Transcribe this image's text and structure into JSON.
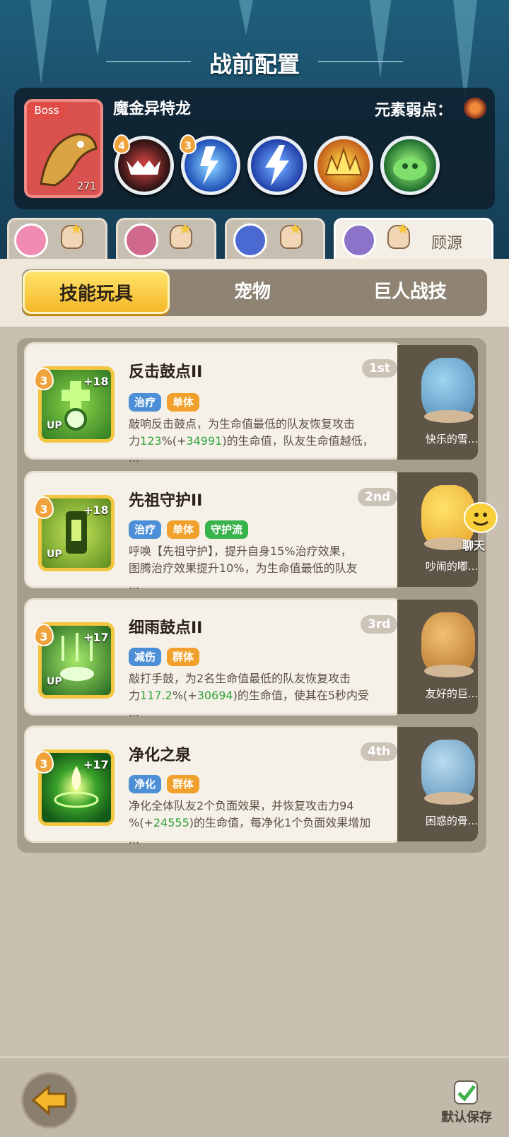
{
  "header": {
    "title": "战前配置"
  },
  "boss": {
    "label": "Boss",
    "level": "271",
    "name": "魔金异特龙",
    "weakness_label": "元素弱点："
  },
  "boss_skills": [
    {
      "icon": "sharp-teeth-mouth-icon",
      "count": "4",
      "color": "#3a1a1a"
    },
    {
      "icon": "multi-lightning-icon",
      "count": "3",
      "color": "#2d74d4"
    },
    {
      "icon": "lightning-bolt-icon",
      "count": "",
      "color": "#3a6ad9"
    },
    {
      "icon": "golden-spike-crown-icon",
      "count": "",
      "color": "#e0892a"
    },
    {
      "icon": "green-slime-icon",
      "count": "",
      "color": "#3da24a"
    }
  ],
  "hero_tabs": [
    {
      "name": "",
      "avatar_color": "#f08bb2"
    },
    {
      "name": "",
      "avatar_color": "#d1688d"
    },
    {
      "name": "",
      "avatar_color": "#4a6ad2"
    },
    {
      "name": "顾源",
      "avatar_color": "#8b73c9"
    }
  ],
  "categories": [
    {
      "label": "技能玩具",
      "active": true
    },
    {
      "label": "宠物",
      "active": false
    },
    {
      "label": "巨人战技",
      "active": false
    }
  ],
  "skills": [
    {
      "name": "反击鼓点II",
      "rank": "1st",
      "level": "3",
      "plus": "+18",
      "up": "UP",
      "tags": [
        {
          "text": "治疗",
          "color": "blue"
        },
        {
          "text": "单体",
          "color": "orange"
        }
      ],
      "desc_line1": "敲响反击鼓点，为生命值最低的队友恢复攻击",
      "desc_line2_a": "力",
      "desc_line2_b": "123",
      "desc_line2_c": "%(+",
      "desc_line2_d": "34991",
      "desc_line2_e": ")的生命值，队友生命值越低，",
      "desc_line3": "...",
      "pet_name": "快乐的雪..."
    },
    {
      "name": "先祖守护II",
      "rank": "2nd",
      "level": "3",
      "plus": "+18",
      "up": "UP",
      "tags": [
        {
          "text": "治疗",
          "color": "blue"
        },
        {
          "text": "单体",
          "color": "orange"
        },
        {
          "text": "守护流",
          "color": "green"
        }
      ],
      "desc_line1": "呼唤【先祖守护】，提升自身15%治疗效果，",
      "desc_line2_a": "图腾治疗效果提升10%，为生命值最低的队友",
      "desc_line2_b": "",
      "desc_line2_c": "",
      "desc_line2_d": "",
      "desc_line2_e": "",
      "desc_line3": "...",
      "pet_name": "吵闹的嘟..."
    },
    {
      "name": "细雨鼓点II",
      "rank": "3rd",
      "level": "3",
      "plus": "+17",
      "up": "UP",
      "tags": [
        {
          "text": "减伤",
          "color": "blue"
        },
        {
          "text": "群体",
          "color": "orange"
        }
      ],
      "desc_line1": "敲打手鼓，为2名生命值最低的队友恢复攻击",
      "desc_line2_a": "力",
      "desc_line2_b": "117.2",
      "desc_line2_c": "%(+",
      "desc_line2_d": "30694",
      "desc_line2_e": ")的生命值，使其在5秒内受",
      "desc_line3": "...",
      "pet_name": "友好的巨..."
    },
    {
      "name": "净化之泉",
      "rank": "4th",
      "level": "3",
      "plus": "+17",
      "up": "",
      "tags": [
        {
          "text": "净化",
          "color": "blue"
        },
        {
          "text": "群体",
          "color": "orange"
        }
      ],
      "desc_line1": "净化全体队友2个负面效果，并恢复攻击力94",
      "desc_line2_a": "%(+",
      "desc_line2_b": "24555",
      "desc_line2_c": ")的生命值，每净化1个负面效果增加",
      "desc_line2_d": "",
      "desc_line2_e": "",
      "desc_line3": "...",
      "pet_name": "困惑的骨..."
    }
  ],
  "chat": {
    "label": "聊天"
  },
  "footer": {
    "save_label": "默认保存"
  }
}
